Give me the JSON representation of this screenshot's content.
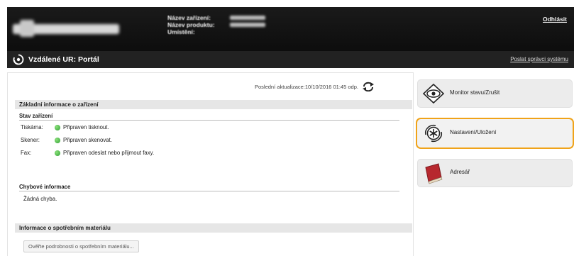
{
  "header": {
    "device_info": [
      {
        "label": "Název zařízení:"
      },
      {
        "label": "Název produktu:"
      },
      {
        "label": "Umístění:"
      }
    ],
    "logout_label": "Odhlásit"
  },
  "portal": {
    "title": "Vzdálené UR: Portál",
    "admin_mail_label": "Poslat správci systému"
  },
  "main": {
    "last_update": "Poslední aktualizace:10/10/2016 01:45 odp.",
    "basic_info": {
      "title": "Základní informace o zařízení",
      "device_status": {
        "title": "Stav zařízení",
        "rows": [
          {
            "label": "Tiskárna:",
            "status": "Připraven tisknout."
          },
          {
            "label": "Skener:",
            "status": "Připraven skenovat."
          },
          {
            "label": "Fax:",
            "status": "Připraven odeslat nebo přijmout faxy."
          }
        ]
      },
      "error_info": {
        "title": "Chybové informace",
        "text": "Žádná chyba."
      }
    },
    "consumables": {
      "title": "Informace o spotřebním materiálu",
      "button_label": "Ověřte podrobnosti o spotřebním materiálu..."
    }
  },
  "menu": [
    {
      "label": "Monitor stavu/Zrušit",
      "icon": "monitor-eye-icon",
      "active": false
    },
    {
      "label": "Nastavení/Uložení",
      "icon": "settings-asterisk-icon",
      "active": true
    },
    {
      "label": "Adresář",
      "icon": "address-book-icon",
      "active": false
    }
  ],
  "colors": {
    "header_bg": "#111111",
    "portal_bg": "#222222",
    "highlight": "#f0a319",
    "status_ok": "#2e9f33"
  }
}
